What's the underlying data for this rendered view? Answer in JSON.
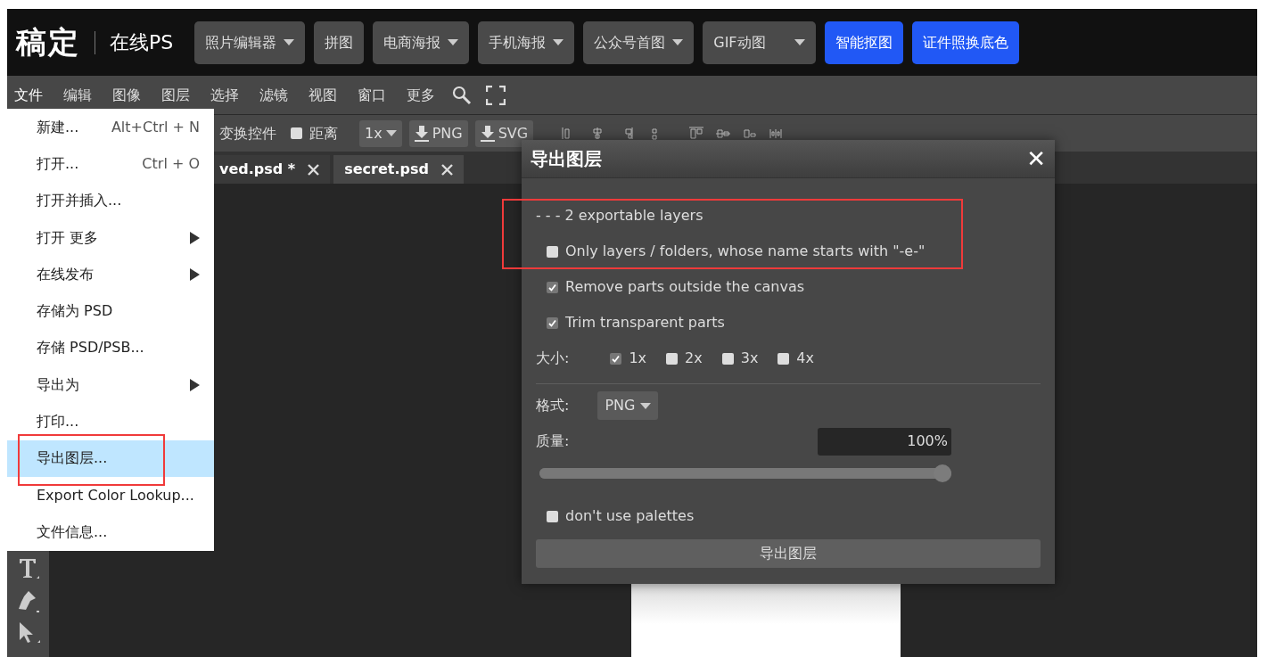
{
  "header": {
    "logo": "稿定",
    "product": "在线PS",
    "nav": [
      {
        "label": "照片编辑器",
        "kind": "dropdown"
      },
      {
        "label": "拼图",
        "kind": "plain"
      },
      {
        "label": "电商海报",
        "kind": "dropdown"
      },
      {
        "label": "手机海报",
        "kind": "dropdown"
      },
      {
        "label": "公众号首图",
        "kind": "dropdown"
      },
      {
        "label": "GIF动图",
        "kind": "dropdown"
      },
      {
        "label": "智能抠图",
        "kind": "primary"
      },
      {
        "label": "证件照换底色",
        "kind": "primary"
      }
    ]
  },
  "menu_bar": {
    "items": [
      {
        "label": "文件",
        "selected": true
      },
      {
        "label": "编辑",
        "selected": false
      },
      {
        "label": "图像",
        "selected": false
      },
      {
        "label": "图层",
        "selected": false
      },
      {
        "label": "选择",
        "selected": false
      },
      {
        "label": "滤镜",
        "selected": false
      },
      {
        "label": "视图",
        "selected": false
      },
      {
        "label": "窗口",
        "selected": false
      },
      {
        "label": "更多",
        "selected": false
      }
    ]
  },
  "options_bar": {
    "transform_label": "变换控件",
    "distance": {
      "label": "距离",
      "checked": false
    },
    "scale": "1x",
    "export_buttons": [
      "PNG",
      "SVG"
    ]
  },
  "tabs": [
    {
      "label": "ved.psd *",
      "selected": false
    },
    {
      "label": "secret.psd",
      "selected": true
    }
  ],
  "file_menu": {
    "items": [
      {
        "label": "新建...",
        "shortcut": "Alt+Ctrl + N",
        "submenu": false,
        "selected": false
      },
      {
        "label": "打开...",
        "shortcut": "Ctrl + O",
        "submenu": false,
        "selected": false
      },
      {
        "label": "打开并插入...",
        "submenu": false,
        "selected": false
      },
      {
        "label": "打开 更多",
        "submenu": true,
        "selected": false
      },
      {
        "label": "在线发布",
        "submenu": true,
        "selected": false
      },
      {
        "label": "存储为 PSD",
        "submenu": false,
        "selected": false
      },
      {
        "label": "存储 PSD/PSB...",
        "submenu": false,
        "selected": false
      },
      {
        "label": "导出为",
        "submenu": true,
        "selected": false
      },
      {
        "label": "打印...",
        "submenu": false,
        "selected": false
      },
      {
        "label": "导出图层...",
        "submenu": false,
        "selected": true
      },
      {
        "label": "Export Color Lookup...",
        "submenu": false,
        "selected": false
      },
      {
        "label": "文件信息...",
        "submenu": false,
        "selected": false
      }
    ]
  },
  "dialog": {
    "title": "导出图层",
    "close": "✕",
    "info": "- - - 2 exportable layers",
    "options": [
      {
        "label": "Only layers / folders, whose name starts with \"-e-\"",
        "checked": false
      },
      {
        "label": "Remove parts outside the canvas",
        "checked": true
      },
      {
        "label": "Trim transparent parts",
        "checked": true
      }
    ],
    "size_label": "大小:",
    "sizes": [
      {
        "label": "1x",
        "checked": true
      },
      {
        "label": "2x",
        "checked": false
      },
      {
        "label": "3x",
        "checked": false
      },
      {
        "label": "4x",
        "checked": false
      }
    ],
    "format_label": "格式:",
    "format": "PNG",
    "quality_label": "质量:",
    "quality": "100%",
    "quality_slider": {
      "level": 1.0
    },
    "palettes": {
      "label": "don't use palettes",
      "checked": false
    },
    "export_button": "导出图层"
  }
}
